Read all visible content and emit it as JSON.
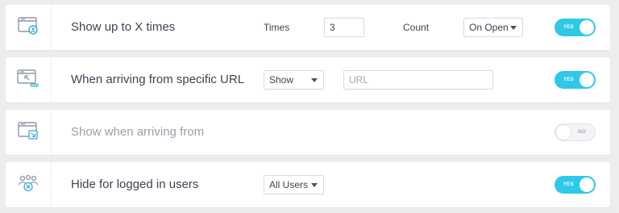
{
  "rules": [
    {
      "title": "Show up to X times",
      "times_label": "Times",
      "times_value": "3",
      "count_label": "Count",
      "count_select": "On Open",
      "toggle": "YES",
      "enabled": true,
      "icon": "window-user-icon"
    },
    {
      "title": "When arriving from specific URL",
      "show_select": "Show",
      "url_placeholder": "URL",
      "toggle": "YES",
      "enabled": true,
      "icon": "window-cursor-icon"
    },
    {
      "title": "Show when arriving from",
      "toggle": "NO",
      "enabled": false,
      "icon": "window-arrow-icon"
    },
    {
      "title": "Hide for logged in users",
      "users_select": "All Users",
      "toggle": "YES",
      "enabled": true,
      "icon": "users-group-icon"
    }
  ],
  "colors": {
    "accent": "#2ec8e8",
    "icon_blue": "#3aa8d8",
    "icon_gray": "#8e97a6"
  }
}
